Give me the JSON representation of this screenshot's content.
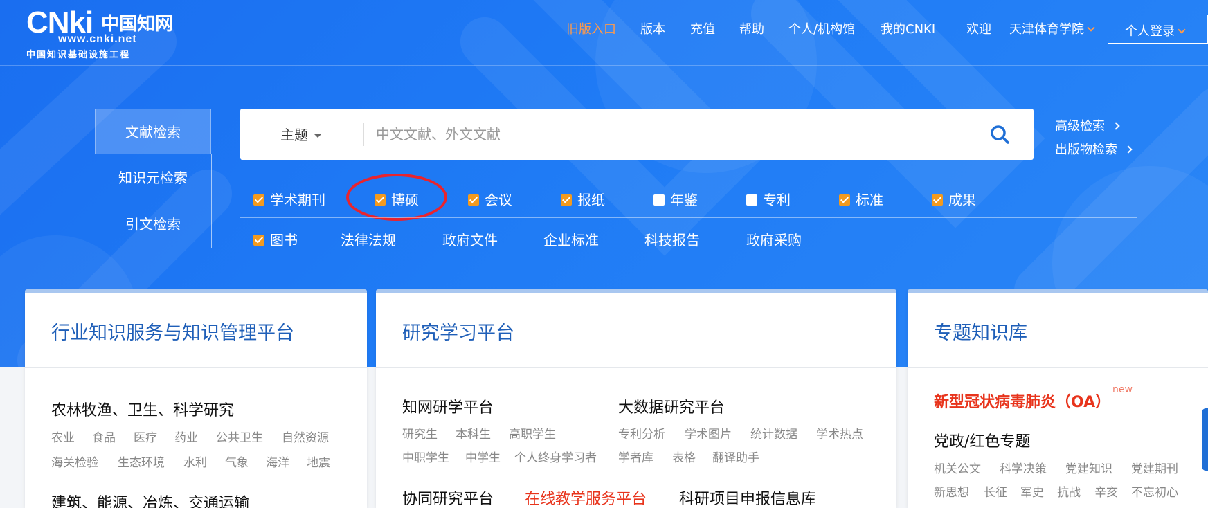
{
  "header": {
    "logo_text": "CNki",
    "logo_cn": "中国知网",
    "logo_url": "www.cnki.net",
    "logo_sub": "中国知识基础设施工程",
    "nav": [
      "旧版入口",
      "版本",
      "充值",
      "帮助",
      "个人/机构馆",
      "我的CNKI"
    ],
    "welcome": "欢迎",
    "institution": "天津体育学院",
    "login": "个人登录"
  },
  "side_tabs": [
    "文献检索",
    "知识元检索",
    "引文检索"
  ],
  "search": {
    "field": "主题",
    "placeholder": "中文文献、外文文献",
    "advanced": "高级检索",
    "publication": "出版物检索"
  },
  "checkboxes_row1": [
    {
      "label": "学术期刊",
      "checked": true
    },
    {
      "label": "博硕",
      "checked": true
    },
    {
      "label": "会议",
      "checked": true
    },
    {
      "label": "报纸",
      "checked": true
    },
    {
      "label": "年鉴",
      "checked": false
    },
    {
      "label": "专利",
      "checked": false
    },
    {
      "label": "标准",
      "checked": true
    },
    {
      "label": "成果",
      "checked": true
    }
  ],
  "row2": {
    "book": {
      "label": "图书",
      "checked": true
    },
    "links": [
      "法律法规",
      "政府文件",
      "企业标准",
      "科技报告",
      "政府采购"
    ]
  },
  "cards": {
    "industry": {
      "title": "行业知识服务与知识管理平台",
      "section1": "农林牧渔、卫生、科学研究",
      "links1": [
        "农业",
        "食品",
        "医疗",
        "药业",
        "公共卫生",
        "自然资源"
      ],
      "links2": [
        "海关检验",
        "生态环境",
        "水利",
        "气象",
        "海洋",
        "地震"
      ],
      "section2": "建筑、能源、冶炼、交通运输"
    },
    "research": {
      "title": "研究学习平台",
      "section_a": "知网研学平台",
      "links_a1": [
        "研究生",
        "本科生",
        "高职学生"
      ],
      "links_a2": [
        "中职学生",
        "中学生",
        "个人终身学习者"
      ],
      "section_b": "大数据研究平台",
      "links_b1": [
        "专利分析",
        "学术图片",
        "统计数据",
        "学术热点"
      ],
      "links_b2": [
        "学者库",
        "表格",
        "翻译助手"
      ],
      "bottom": [
        "协同研究平台",
        "在线教学服务平台",
        "科研项目申报信息库"
      ]
    },
    "topic": {
      "title": "专题知识库",
      "covid": "新型冠状病毒肺炎（OA）",
      "new_badge": "new",
      "section": "党政/红色专题",
      "links1": [
        "机关公文",
        "科学决策",
        "党建知识",
        "党建期刊"
      ],
      "links2": [
        "新思想",
        "长征",
        "军史",
        "抗战",
        "辛亥",
        "不忘初心"
      ]
    }
  },
  "colors": {
    "hero_blue": "#1f7bf5",
    "accent_orange": "#ff9a4a",
    "checkbox_orange": "#f39a1e",
    "highlight_red": "#e8242e",
    "card_title_blue": "#1f5fb8"
  }
}
